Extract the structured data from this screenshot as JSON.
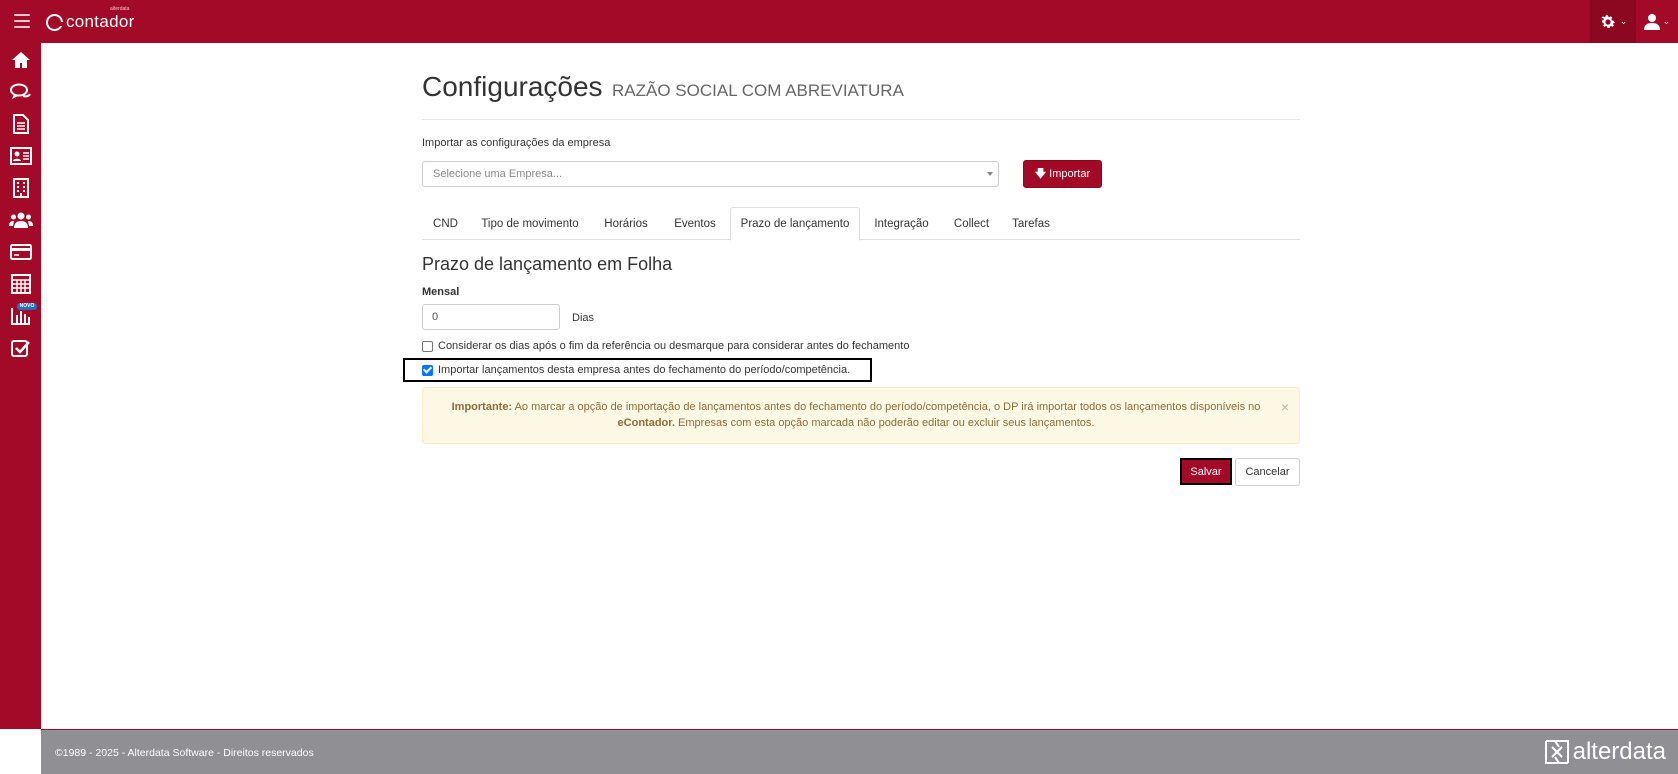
{
  "topbar": {
    "logo_text": "contador",
    "logo_small": "alterdata"
  },
  "sidebar": {
    "items": [
      {
        "name": "home-icon"
      },
      {
        "name": "chat-icon"
      },
      {
        "name": "document-icon"
      },
      {
        "name": "id-card-icon"
      },
      {
        "name": "building-icon"
      },
      {
        "name": "users-icon"
      },
      {
        "name": "credit-card-icon"
      },
      {
        "name": "calculator-icon"
      },
      {
        "name": "bar-chart-icon"
      },
      {
        "name": "checkbox-icon"
      }
    ],
    "novo_badge": "NOVO"
  },
  "page": {
    "title": "Configurações",
    "subtitle": "RAZÃO SOCIAL COM ABREVIATURA"
  },
  "import": {
    "label": "Importar as configurações da empresa",
    "select_placeholder": "Selecione uma Empresa...",
    "button_label": "Importar"
  },
  "tabs": [
    {
      "label": "CND",
      "active": false
    },
    {
      "label": "Tipo de movimento",
      "active": false
    },
    {
      "label": "Horários",
      "active": false
    },
    {
      "label": "Eventos",
      "active": false
    },
    {
      "label": "Prazo de lançamento",
      "active": true
    },
    {
      "label": "Integração",
      "active": false
    },
    {
      "label": "Collect",
      "active": false
    },
    {
      "label": "Tarefas",
      "active": false
    }
  ],
  "section": {
    "title": "Prazo de lançamento em Folha",
    "mensal_label": "Mensal",
    "mensal_value": "0",
    "dias_label": "Dias"
  },
  "checkboxes": {
    "considerar": {
      "label": "Considerar os dias após o fim da referência ou desmarque para considerar antes do fechamento",
      "checked": false
    },
    "importar": {
      "label": "Importar lançamentos desta empresa antes do fechamento do período/competência.",
      "checked": true
    }
  },
  "alert": {
    "strong": "Importante:",
    "text1": " Ao marcar a opção de importação de lançamentos antes do fechamento do período/competência, o DP irá importar todos os lançamentos disponíveis no ",
    "brand": "eContador.",
    "text2": " Empresas com esta opção marcada não poderão editar ou excluir seus lançamentos.",
    "close": "×"
  },
  "actions": {
    "save_label": "Salvar",
    "cancel_label": "Cancelar"
  },
  "footer": {
    "copyright": "©1989 - 2025 - Alterdata Software - Direitos reservados",
    "brand": "alterdata"
  },
  "colors": {
    "brand": "#a30a27",
    "footer": "#8f8f94",
    "alert_bg": "#fcf8e3",
    "alert_text": "#8a6d3b"
  }
}
